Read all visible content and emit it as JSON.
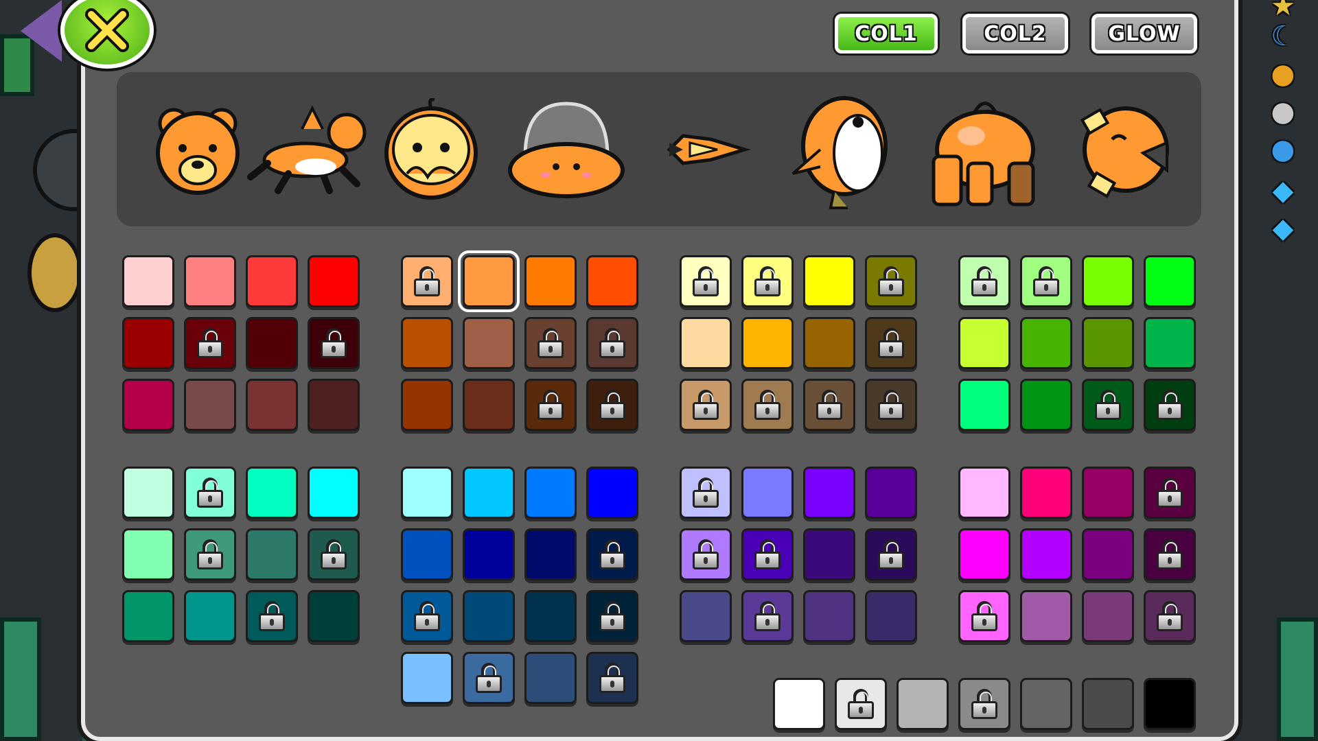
{
  "tabs": [
    {
      "label": "COL1",
      "active": true
    },
    {
      "label": "COL2",
      "active": false
    },
    {
      "label": "GLOW",
      "active": false
    }
  ],
  "preview_icons": [
    "bear-icon",
    "dog-icon",
    "onion-face-icon",
    "hamster-dome-icon",
    "ship-icon",
    "bird-icon",
    "robot-creature-icon",
    "spider-ball-icon"
  ],
  "icon_color": "#ff9a33",
  "selected_color": "#ff9a40",
  "palette_groups": [
    {
      "name": "reds",
      "rows": [
        [
          {
            "c": "#ffd0d0",
            "l": false
          },
          {
            "c": "#ff8080",
            "l": false
          },
          {
            "c": "#ff3a3a",
            "l": false
          },
          {
            "c": "#ff0000",
            "l": false
          }
        ],
        [
          {
            "c": "#9a0000",
            "l": false
          },
          {
            "c": "#6a0008",
            "l": true
          },
          {
            "c": "#520006",
            "l": false
          },
          {
            "c": "#3e0008",
            "l": true
          }
        ],
        [
          {
            "c": "#b40048",
            "l": false
          },
          {
            "c": "#7a4a4a",
            "l": false
          },
          {
            "c": "#7a3232",
            "l": false
          },
          {
            "c": "#4e2020",
            "l": false
          }
        ]
      ]
    },
    {
      "name": "oranges",
      "rows": [
        [
          {
            "c": "#ffb070",
            "l": true
          },
          {
            "c": "#ff9a40",
            "l": false,
            "sel": true
          },
          {
            "c": "#ff7a00",
            "l": false
          },
          {
            "c": "#ff4e00",
            "l": false
          }
        ],
        [
          {
            "c": "#b85000",
            "l": false
          },
          {
            "c": "#a06048",
            "l": false
          },
          {
            "c": "#6a4030",
            "l": true
          },
          {
            "c": "#5a3a30",
            "l": true
          }
        ],
        [
          {
            "c": "#963400",
            "l": false
          },
          {
            "c": "#6a2e1a",
            "l": false
          },
          {
            "c": "#5a2a0a",
            "l": true
          },
          {
            "c": "#3e1e0c",
            "l": true
          }
        ]
      ]
    },
    {
      "name": "yellows",
      "rows": [
        [
          {
            "c": "#ffffc0",
            "l": true
          },
          {
            "c": "#ffff80",
            "l": true
          },
          {
            "c": "#ffff00",
            "l": false
          },
          {
            "c": "#7a7a00",
            "l": true
          }
        ],
        [
          {
            "c": "#ffdaa0",
            "l": false
          },
          {
            "c": "#ffb400",
            "l": false
          },
          {
            "c": "#966400",
            "l": false
          },
          {
            "c": "#4e3a1a",
            "l": true
          }
        ],
        [
          {
            "c": "#c89a6a",
            "l": true
          },
          {
            "c": "#a07a50",
            "l": true
          },
          {
            "c": "#6a5038",
            "l": true
          },
          {
            "c": "#4a3a2a",
            "l": true
          }
        ]
      ]
    },
    {
      "name": "greens",
      "rows": [
        [
          {
            "c": "#c0ffb0",
            "l": true
          },
          {
            "c": "#a0ff80",
            "l": true
          },
          {
            "c": "#78ff00",
            "l": false
          },
          {
            "c": "#00ff14",
            "l": false
          }
        ],
        [
          {
            "c": "#c8ff30",
            "l": false
          },
          {
            "c": "#46b400",
            "l": false
          },
          {
            "c": "#5a9600",
            "l": false
          },
          {
            "c": "#00b44a",
            "l": false
          }
        ],
        [
          {
            "c": "#00ff7a",
            "l": false
          },
          {
            "c": "#009614",
            "l": false
          },
          {
            "c": "#005a1a",
            "l": true
          },
          {
            "c": "#003e12",
            "l": true
          }
        ]
      ]
    },
    {
      "name": "cyans",
      "rows": [
        [
          {
            "c": "#c0ffe0",
            "l": false
          },
          {
            "c": "#80ffd8",
            "l": true
          },
          {
            "c": "#00ffc0",
            "l": false
          },
          {
            "c": "#00ffff",
            "l": false
          }
        ],
        [
          {
            "c": "#80ffb0",
            "l": false
          },
          {
            "c": "#3e9a7a",
            "l": true
          },
          {
            "c": "#2e7a6a",
            "l": false
          },
          {
            "c": "#1e5a4e",
            "l": true
          }
        ],
        [
          {
            "c": "#00966a",
            "l": false
          },
          {
            "c": "#00968e",
            "l": false
          },
          {
            "c": "#005a5a",
            "l": true
          },
          {
            "c": "#003e3a",
            "l": false
          }
        ]
      ]
    },
    {
      "name": "blues",
      "rows": [
        [
          {
            "c": "#a0ffff",
            "l": false
          },
          {
            "c": "#00c8ff",
            "l": false
          },
          {
            "c": "#007aff",
            "l": false
          },
          {
            "c": "#0000ff",
            "l": false
          }
        ],
        [
          {
            "c": "#0050c0",
            "l": false
          },
          {
            "c": "#00009a",
            "l": false
          },
          {
            "c": "#000a6a",
            "l": false
          },
          {
            "c": "#001a4a",
            "l": true
          }
        ],
        [
          {
            "c": "#005a9a",
            "l": true
          },
          {
            "c": "#004a7a",
            "l": false
          },
          {
            "c": "#003250",
            "l": false
          },
          {
            "c": "#002238",
            "l": true
          }
        ],
        [
          {
            "c": "#78c0ff",
            "l": false
          },
          {
            "c": "#3a6aa0",
            "l": true
          },
          {
            "c": "#2e4e7a",
            "l": false
          },
          {
            "c": "#1e3050",
            "l": true
          }
        ]
      ]
    },
    {
      "name": "purples",
      "rows": [
        [
          {
            "c": "#c0c0ff",
            "l": true
          },
          {
            "c": "#7a7aff",
            "l": false
          },
          {
            "c": "#7a00ff",
            "l": false
          },
          {
            "c": "#5a009a",
            "l": false
          }
        ],
        [
          {
            "c": "#b07aff",
            "l": true
          },
          {
            "c": "#4a00b4",
            "l": true
          },
          {
            "c": "#3a0a7a",
            "l": false
          },
          {
            "c": "#2a0a5a",
            "l": true
          }
        ],
        [
          {
            "c": "#4a4a8a",
            "l": false
          },
          {
            "c": "#5a3a96",
            "l": true
          },
          {
            "c": "#503282",
            "l": false
          },
          {
            "c": "#3a2a6a",
            "l": false
          }
        ]
      ]
    },
    {
      "name": "pinks",
      "rows": [
        [
          {
            "c": "#ffb8ff",
            "l": false
          },
          {
            "c": "#ff007a",
            "l": false
          },
          {
            "c": "#960064",
            "l": false
          },
          {
            "c": "#5a0040",
            "l": true
          }
        ],
        [
          {
            "c": "#ff00ff",
            "l": false
          },
          {
            "c": "#b400ff",
            "l": false
          },
          {
            "c": "#7a0080",
            "l": false
          },
          {
            "c": "#4a0040",
            "l": true
          }
        ],
        [
          {
            "c": "#ff64ff",
            "l": true
          },
          {
            "c": "#a05aa8",
            "l": false
          },
          {
            "c": "#7a3a7a",
            "l": false
          },
          {
            "c": "#5a2a5a",
            "l": true
          }
        ]
      ]
    },
    {
      "name": "grays",
      "rows": [
        [
          {
            "c": "#ffffff",
            "l": false
          },
          {
            "c": "#e8e8e8",
            "l": true
          },
          {
            "c": "#b4b4b4",
            "l": false
          },
          {
            "c": "#8a8a8a",
            "l": true
          },
          {
            "c": "#646464",
            "l": false
          },
          {
            "c": "#4a4a4a",
            "l": false
          },
          {
            "c": "#000000",
            "l": false
          }
        ]
      ]
    }
  ],
  "side_icons": [
    "star-icon",
    "moon-icon",
    "coin-icon",
    "user-coin-icon",
    "orbs-icon",
    "diamond-icon",
    "diamonds-icon"
  ]
}
